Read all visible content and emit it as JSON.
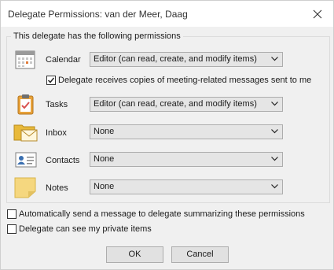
{
  "window": {
    "title": "Delegate Permissions: van der Meer, Daag"
  },
  "group": {
    "label": "This delegate has the following permissions"
  },
  "rows": [
    {
      "label": "Calendar",
      "value": "Editor (can read, create, and modify items)",
      "icon": "calendar-icon"
    },
    {
      "label": "Tasks",
      "value": "Editor (can read, create, and modify items)",
      "icon": "tasks-clipboard-icon"
    },
    {
      "label": "Inbox",
      "value": "None",
      "icon": "inbox-envelope-icon"
    },
    {
      "label": "Contacts",
      "value": "None",
      "icon": "contact-card-icon"
    },
    {
      "label": "Notes",
      "value": "None",
      "icon": "sticky-note-icon"
    }
  ],
  "meeting_copies": {
    "label": "Delegate receives copies of meeting-related messages sent to me",
    "checked": true
  },
  "options": [
    {
      "label": "Automatically send a message to delegate summarizing these permissions",
      "checked": false
    },
    {
      "label": "Delegate can see my private items",
      "checked": false
    }
  ],
  "buttons": {
    "ok": "OK",
    "cancel": "Cancel"
  },
  "colors": {
    "window_bg": "#f0f0f0",
    "title_bg": "#ffffff",
    "combo_bg": "#e5e5e5",
    "border": "#adadad"
  }
}
